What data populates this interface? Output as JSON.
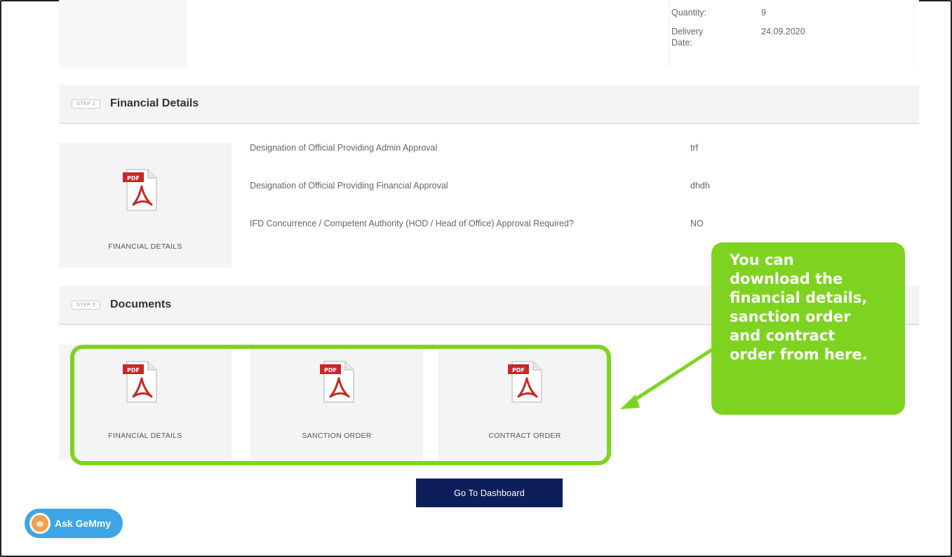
{
  "top_card": {
    "quantity_label": "Quantity:",
    "quantity_value": "9",
    "delivery_label": "Delivery\nDate:",
    "delivery_value": "24.09.2020"
  },
  "step2": {
    "badge": "STEP 2",
    "title": "Financial Details",
    "doc_label": "FINANCIAL DETAILS",
    "rows": [
      {
        "label": "Designation of Official Providing Admin Approval",
        "value": "trf"
      },
      {
        "label": "Designation of Official Providing Financial Approval",
        "value": "dhdh"
      },
      {
        "label": "IFD Concurrence / Competent Authority (HOD / Head of Office) Approval Required?",
        "value": "NO"
      }
    ]
  },
  "step3": {
    "badge": "STEP 3",
    "title": "Documents",
    "docs": [
      {
        "label": "FINANCIAL DETAILS"
      },
      {
        "label": "SANCTION ORDER"
      },
      {
        "label": "CONTRACT ORDER"
      }
    ]
  },
  "pdf_icon_text": "PDF",
  "callout": {
    "text": "You can\ndownload the\nfinancial details,\nsanction order\nand contract\norder from here.",
    "color": "#7ed321"
  },
  "buttons": {
    "dashboard": "Go To Dashboard"
  },
  "assistant": {
    "label": "Ask GeMmy",
    "color": "#3ea5e6"
  },
  "icons": {
    "pdf": "pdf-file-icon",
    "avatar": "gemmy-avatar-icon"
  }
}
